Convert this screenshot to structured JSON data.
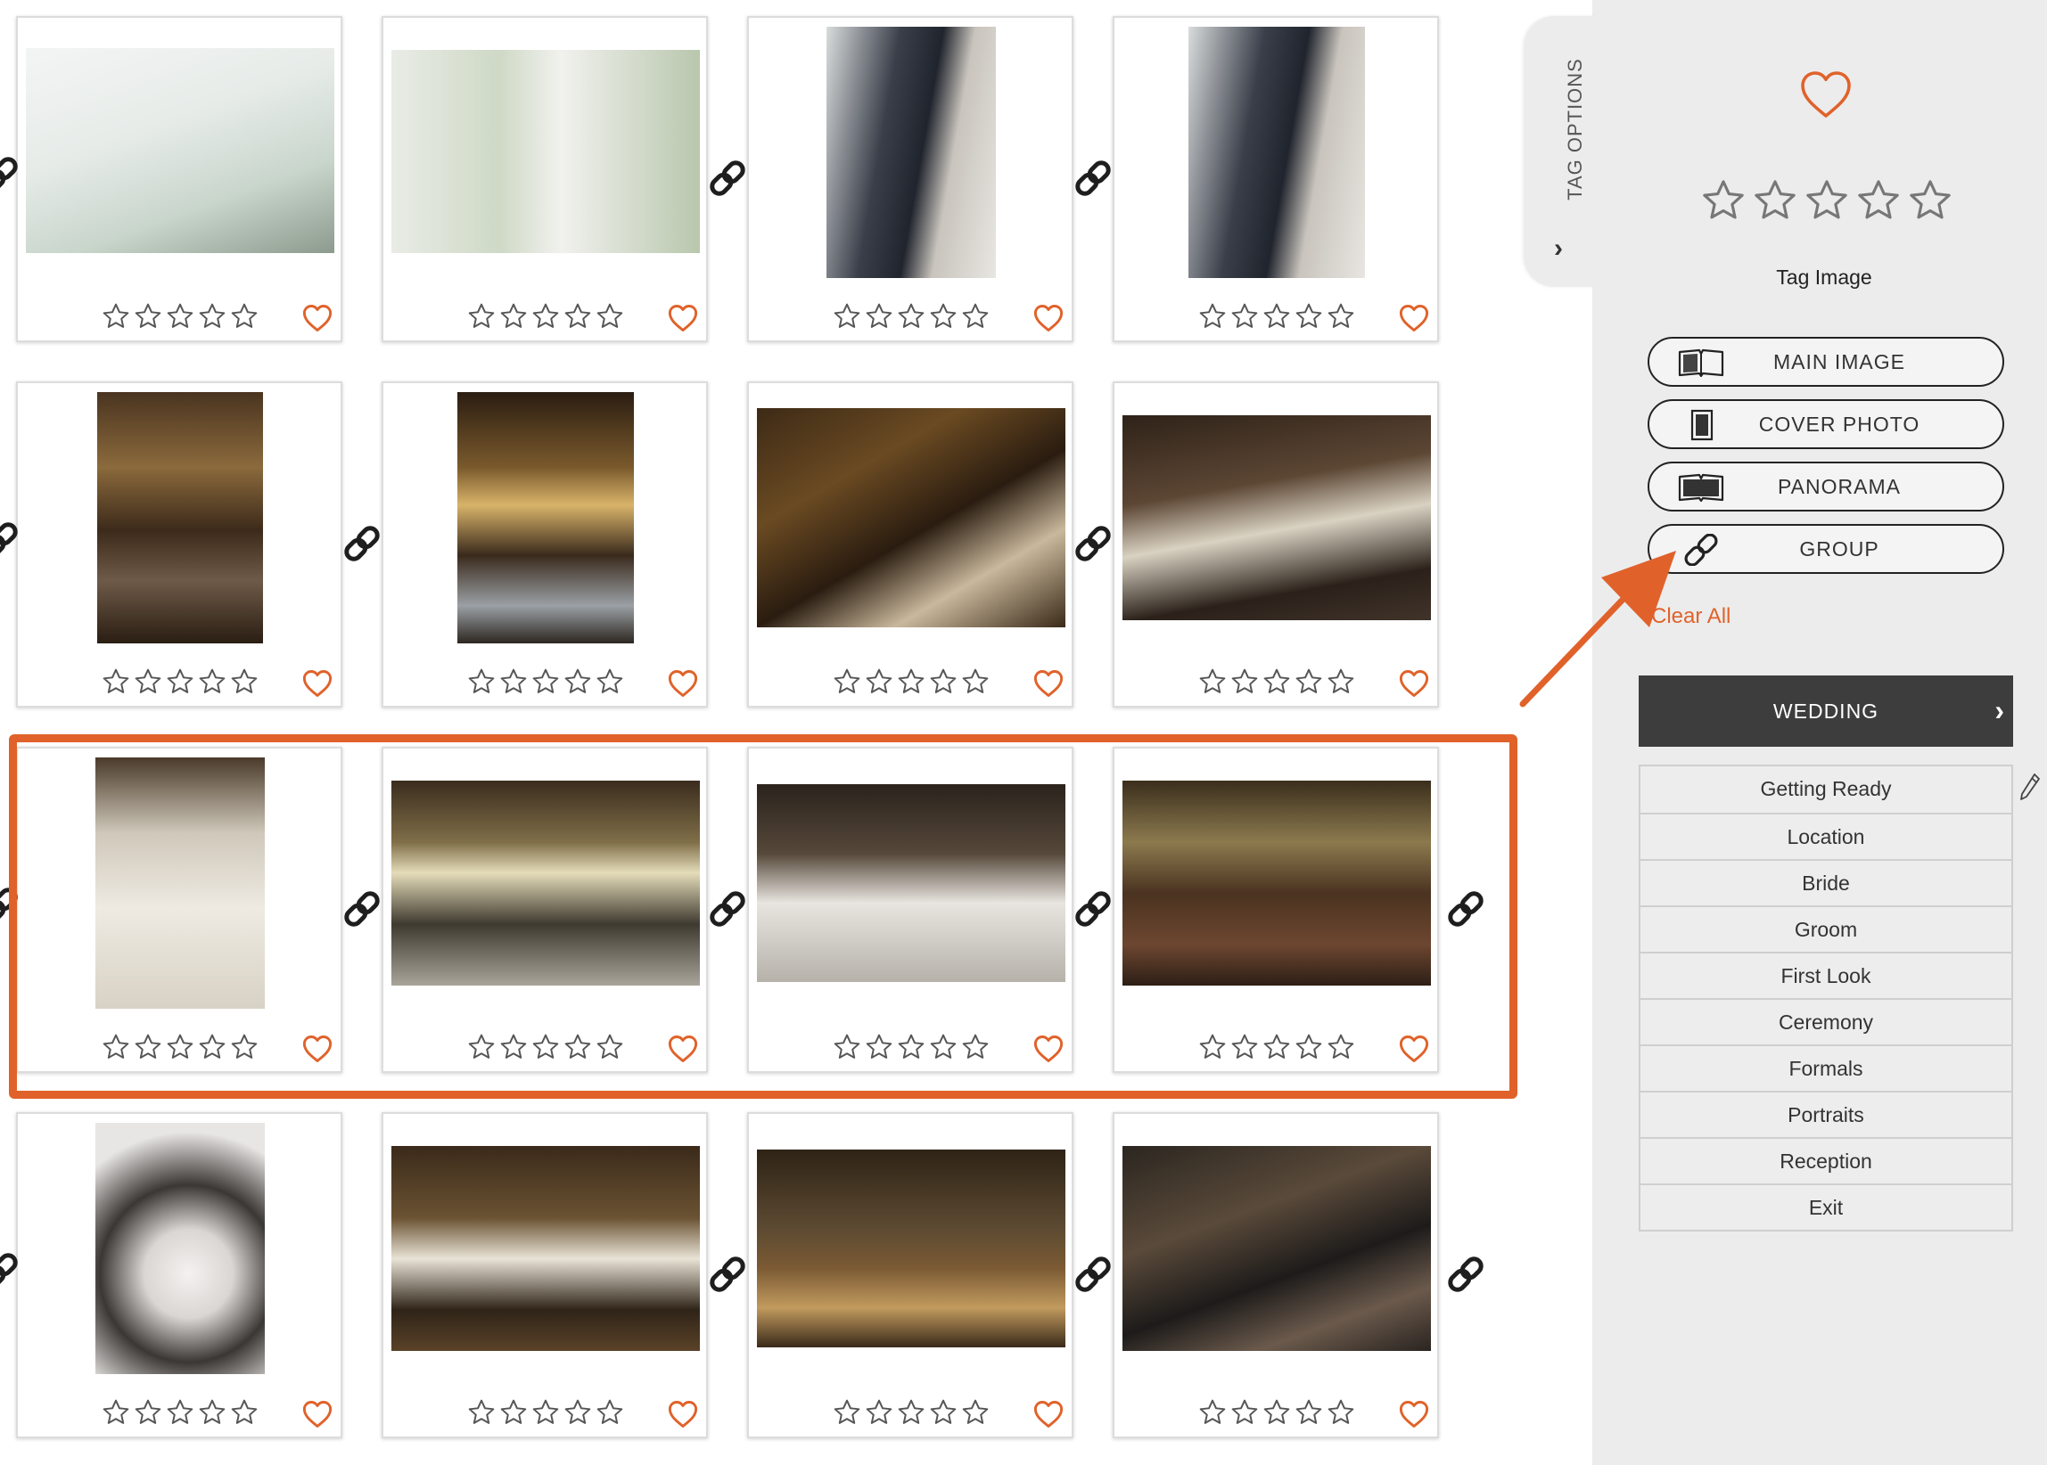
{
  "colors": {
    "accent": "#e0622a",
    "panel_bg": "#ececec",
    "dark_bar": "#3d3d3d"
  },
  "grid": {
    "rows": [
      {
        "cards": [
          {
            "photo": "window-bride",
            "rating": 0,
            "favorite": false
          },
          {
            "photo": "bride-back",
            "rating": 0,
            "favorite": false
          },
          {
            "photo": "couple-portrait",
            "rating": 0,
            "favorite": false
          },
          {
            "photo": "couple-portrait",
            "rating": 0,
            "favorite": false
          }
        ],
        "links": [
          "link-icon",
          "link-icon",
          "link-icon"
        ]
      },
      {
        "cards": [
          {
            "photo": "reception-hall",
            "rating": 0,
            "favorite": false
          },
          {
            "photo": "reception-flowers",
            "rating": 0,
            "favorite": false
          },
          {
            "photo": "chapel-couple",
            "rating": 0,
            "favorite": false
          },
          {
            "photo": "hall-couple",
            "rating": 0,
            "favorite": false
          }
        ],
        "links": [
          "link-icon",
          "link-icon",
          "link-icon"
        ]
      },
      {
        "cards": [
          {
            "photo": "table-setting",
            "rating": 0,
            "favorite": false
          },
          {
            "photo": "floral-centerpieces",
            "rating": 0,
            "favorite": false
          },
          {
            "photo": "long-table",
            "rating": 0,
            "favorite": false
          },
          {
            "photo": "banquet-room",
            "rating": 0,
            "favorite": false
          }
        ],
        "links": [
          "link-icon",
          "link-icon",
          "link-icon",
          "link-icon"
        ]
      },
      {
        "cards": [
          {
            "photo": "place-card",
            "rating": 0,
            "favorite": false
          },
          {
            "photo": "first-dance",
            "rating": 0,
            "favorite": false
          },
          {
            "photo": "dance-floor",
            "rating": 0,
            "favorite": false
          },
          {
            "photo": "couple-hug",
            "rating": 0,
            "favorite": false
          }
        ],
        "links": [
          "link-icon",
          "link-icon",
          "link-icon",
          "link-icon"
        ]
      }
    ]
  },
  "panel": {
    "tab_label": "TAG OPTIONS",
    "tab_chevron": "›",
    "rating": 0,
    "favorite": false,
    "tag_title": "Tag Image",
    "buttons": [
      {
        "label": "MAIN IMAGE",
        "icon": "open-book-icon"
      },
      {
        "label": "COVER PHOTO",
        "icon": "cover-photo-icon"
      },
      {
        "label": "PANORAMA",
        "icon": "panorama-icon"
      },
      {
        "label": "GROUP",
        "icon": "link-icon"
      }
    ],
    "clear_all": "Clear All",
    "category_header": "WEDDING",
    "category_chevron": "›",
    "categories": [
      "Getting Ready",
      "Location",
      "Bride",
      "Groom",
      "First Look",
      "Ceremony",
      "Formals",
      "Portraits",
      "Reception",
      "Exit"
    ]
  }
}
